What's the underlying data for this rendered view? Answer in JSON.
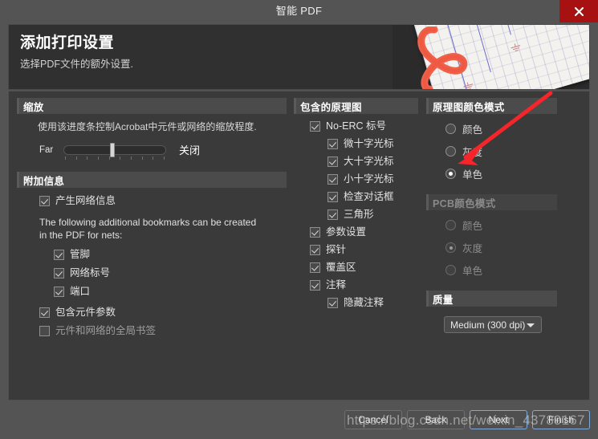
{
  "window": {
    "title": "智能 PDF",
    "close_icon": "close-x-icon"
  },
  "header": {
    "title": "添加打印设置",
    "subtitle": "选择PDF文件的额外设置."
  },
  "zoom_section": {
    "heading": "缩放",
    "description": "使用该进度条控制Acrobat中元件或网络的缩放程度.",
    "slider_label": "Far",
    "slider_value_label": "关闭",
    "slider_position_percent": 47
  },
  "additional_section": {
    "heading": "附加信息",
    "generate_net_info": {
      "label": "产生网络信息",
      "checked": true
    },
    "bookmark_note": "The following additional bookmarks can be created in the PDF for nets:",
    "bookmark_items": [
      {
        "label": "管脚",
        "checked": true
      },
      {
        "label": "网络标号",
        "checked": true
      },
      {
        "label": "端口",
        "checked": true
      }
    ],
    "extra_items": [
      {
        "label": "包含元件参数",
        "checked": true,
        "dim": false
      },
      {
        "label": "元件和网络的全局书签",
        "checked": false,
        "dim": true
      }
    ]
  },
  "schematics_section": {
    "heading": "包含的原理图",
    "items": [
      {
        "label": "No-ERC 标号",
        "checked": true,
        "level": 0
      },
      {
        "label": "微十字光标",
        "checked": true,
        "level": 1
      },
      {
        "label": "大十字光标",
        "checked": true,
        "level": 1
      },
      {
        "label": "小十字光标",
        "checked": true,
        "level": 1
      },
      {
        "label": "检查对话框",
        "checked": true,
        "level": 1
      },
      {
        "label": "三角形",
        "checked": true,
        "level": 1
      },
      {
        "label": "参数设置",
        "checked": true,
        "level": 0
      },
      {
        "label": "探针",
        "checked": true,
        "level": 0
      },
      {
        "label": "覆盖区",
        "checked": true,
        "level": 0
      },
      {
        "label": "注释",
        "checked": true,
        "level": 0
      },
      {
        "label": "隐藏注释",
        "checked": true,
        "level": 1
      }
    ]
  },
  "sch_color_section": {
    "heading": "原理图颜色模式",
    "options": [
      {
        "label": "颜色",
        "selected": false
      },
      {
        "label": "灰度",
        "selected": false
      },
      {
        "label": "单色",
        "selected": true
      }
    ]
  },
  "pcb_color_section": {
    "heading": "PCB颜色模式",
    "disabled": true,
    "options": [
      {
        "label": "颜色",
        "selected": false
      },
      {
        "label": "灰度",
        "selected": true
      },
      {
        "label": "单色",
        "selected": false
      }
    ]
  },
  "quality_section": {
    "heading": "质量",
    "selected": "Medium (300 dpi)"
  },
  "footer": {
    "buttons": [
      {
        "label": "Cancel",
        "focus": false
      },
      {
        "label": "Back",
        "focus": false
      },
      {
        "label": "Next",
        "focus": true
      },
      {
        "label": "Finish",
        "focus": true
      }
    ]
  },
  "overlay": {
    "watermark": "https://blog.csdn.net/weixin_43789167",
    "arrow_color": "#f5252a",
    "arrow_name": "annotation-arrow"
  },
  "colors": {
    "window_bg": "#545454",
    "panel_bg": "#3a3a3a",
    "section_head_bg": "#4b4b4b",
    "close_red": "#a81111",
    "accent_text": "#ffffff"
  }
}
